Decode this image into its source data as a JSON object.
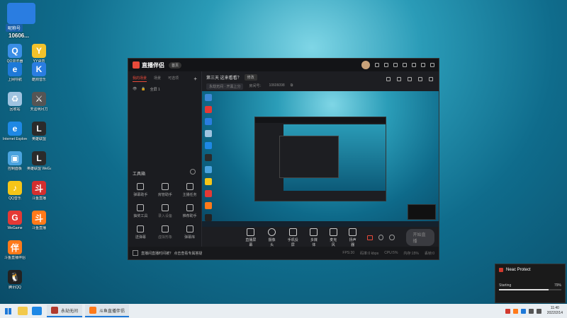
{
  "desktop": {
    "qq_account": {
      "label": "昵称号",
      "number": "10606..."
    },
    "icons": [
      {
        "label": "QQ浏览器",
        "color": "#3a8ee6",
        "glyph": "Q"
      },
      {
        "label": "YY语音",
        "color": "#f3c22b",
        "glyph": "Y"
      },
      {
        "label": "上网导航",
        "color": "#1e79d8",
        "glyph": "e"
      },
      {
        "label": "酷狗音乐",
        "color": "#2a7de1",
        "glyph": "K"
      },
      {
        "label": "回收站",
        "color": "#9fc3e0",
        "glyph": "♻"
      },
      {
        "label": "天涯明月刀",
        "color": "#555",
        "glyph": "⚔"
      },
      {
        "label": "Internet Explorer",
        "color": "#1e88e5",
        "glyph": "e"
      },
      {
        "label": "英雄联盟",
        "color": "#2b2b2b",
        "glyph": "L"
      },
      {
        "label": "控制面板",
        "color": "#4aa3df",
        "glyph": "▣"
      },
      {
        "label": "英雄联盟 WeGame版",
        "color": "#2b2b2b",
        "glyph": "L"
      },
      {
        "label": "QQ音乐",
        "color": "#f5c518",
        "glyph": "♪"
      },
      {
        "label": "斗鱼直播",
        "color": "#d32f2f",
        "glyph": "斗"
      },
      {
        "label": "WeGame",
        "color": "#e53935",
        "glyph": "G"
      },
      {
        "label": "斗鱼直播",
        "color": "#ff7a1a",
        "glyph": "斗"
      },
      {
        "label": "斗鱼直播伴侣",
        "color": "#ff7a1a",
        "glyph": "伴"
      },
      {
        "label": "腾讯QQ",
        "color": "#222",
        "glyph": "🐧"
      }
    ]
  },
  "app": {
    "brand": "直播伴侣",
    "version_badge": "首页",
    "left_tabs": [
      "我的场景",
      "场景",
      "可选项"
    ],
    "scene_name": "全屏 1",
    "tools_title": "工具箱",
    "tools": [
      {
        "label": "弹幕助手"
      },
      {
        "label": "房管助手"
      },
      {
        "label": "主播任务"
      },
      {
        "label": "抽奖工具"
      },
      {
        "label": "录入设备"
      },
      {
        "label": "推荐助手"
      },
      {
        "label": "送弹幕"
      },
      {
        "label": "虚拟形象"
      },
      {
        "label": "弹幕库"
      }
    ],
    "live_title": "第三天 这来看看？",
    "edit_label": "修改",
    "category": "永劫无间 · 开黑上分",
    "room_label": "房间号：",
    "room_number": "10606098",
    "controls": [
      {
        "label": "直播屏幕"
      },
      {
        "label": "摄像头"
      },
      {
        "label": "手机投屏"
      },
      {
        "label": "多媒体"
      },
      {
        "label": "麦克风"
      },
      {
        "label": "扬声器"
      }
    ],
    "start_button": "开始直播",
    "status_question": "直播间直播时间被？ 点击查看专属答疑",
    "status_stats": [
      "FPS:30",
      "码率:0 kbps",
      "CPU:5%",
      "内存:15%",
      "丢帧:0"
    ]
  },
  "neac": {
    "title": "Neac Protect",
    "status": "Starting",
    "progress_label": "79%",
    "progress": 0.79
  },
  "taskbar": {
    "tasks": [
      {
        "label": "永劫无间",
        "color": "#b13a2e"
      },
      {
        "label": "斗鱼直播伴侣",
        "color": "#ff7a1a"
      }
    ],
    "time": "11:40",
    "date": "2022/2/14"
  }
}
